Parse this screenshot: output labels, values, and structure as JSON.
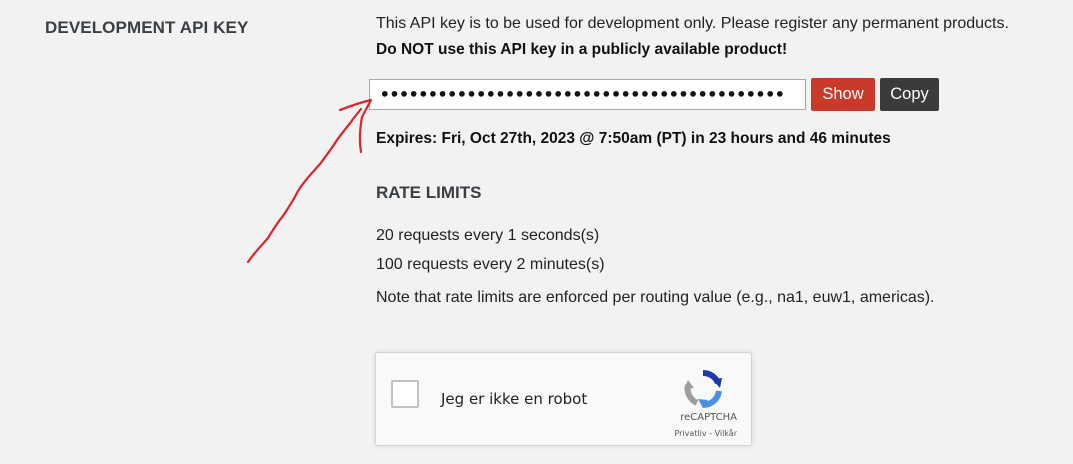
{
  "section": {
    "label": "DEVELOPMENT API KEY"
  },
  "api_key": {
    "intro": "This API key is to be used for development only. Please register any permanent products.",
    "warning": "Do NOT use this API key in a publicly available product!",
    "masked_value": "••••••••••••••••••••••••••••••••••••••••••",
    "show_label": "Show",
    "copy_label": "Copy",
    "expires": "Expires: Fri, Oct 27th, 2023 @ 7:50am (PT) in 23 hours and 46 minutes"
  },
  "rate_limits": {
    "title": "RATE LIMITS",
    "items": [
      "20 requests every 1 seconds(s)",
      "100 requests every 2 minutes(s)"
    ],
    "note": "Note that rate limits are enforced per routing value (e.g., na1, euw1, americas)."
  },
  "captcha": {
    "label": "Jeg er ikke en robot",
    "brand": "reCAPTCHA",
    "privacy_link": "Privatliv",
    "separator": " - ",
    "terms_link": "Vilkår",
    "icon": "recaptcha-icon"
  },
  "annotation": {
    "icon": "hand-drawn-arrow",
    "color": "#d9262c"
  },
  "colors": {
    "background": "#f2f2f2",
    "show_button": "#c93a2b",
    "copy_button": "#3b3b3b",
    "heading": "#3a3f44"
  }
}
